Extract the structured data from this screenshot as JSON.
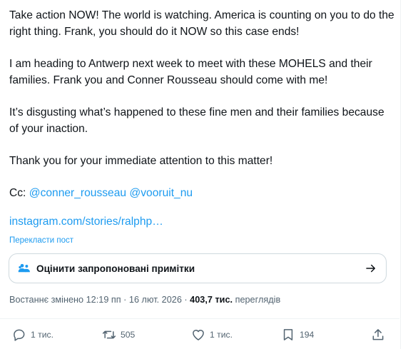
{
  "post": {
    "paragraphs": [
      "Take action NOW!  The world is watching. America is counting on you to do the right thing. Frank, you should do it NOW so this case ends!",
      "I am heading to Antwerp next week to meet with these MOHELS and their families.  Frank you and Conner Rousseau should come with me!",
      "It’s disgusting what’s happened to these fine men and their families because of your inaction.",
      "Thank you for your immediate attention to this matter!"
    ],
    "cc_prefix": "Cc: ",
    "mentions": [
      "@conner_rousseau",
      "@vooruit_nu"
    ],
    "link_text": "instagram.com/stories/ralphp…",
    "translate_label": "Перекласти пост"
  },
  "community_notes": {
    "label": "Оцінити запропоновані примітки",
    "icon": "people-icon",
    "arrow": "arrow-right-icon"
  },
  "meta": {
    "edited_label": "Востаннє змінено",
    "time": "12:19 пп",
    "separator": " · ",
    "date": "16 лют. 2026",
    "views_count": "403,7 тис.",
    "views_label": "переглядів"
  },
  "actions": {
    "reply_count": "1 тис.",
    "repost_count": "505",
    "like_count": "1 тис.",
    "bookmark_count": "194"
  },
  "colors": {
    "accent": "#1d9bf0",
    "text": "#0f1419",
    "secondary": "#536471",
    "border": "#cfd9de"
  }
}
